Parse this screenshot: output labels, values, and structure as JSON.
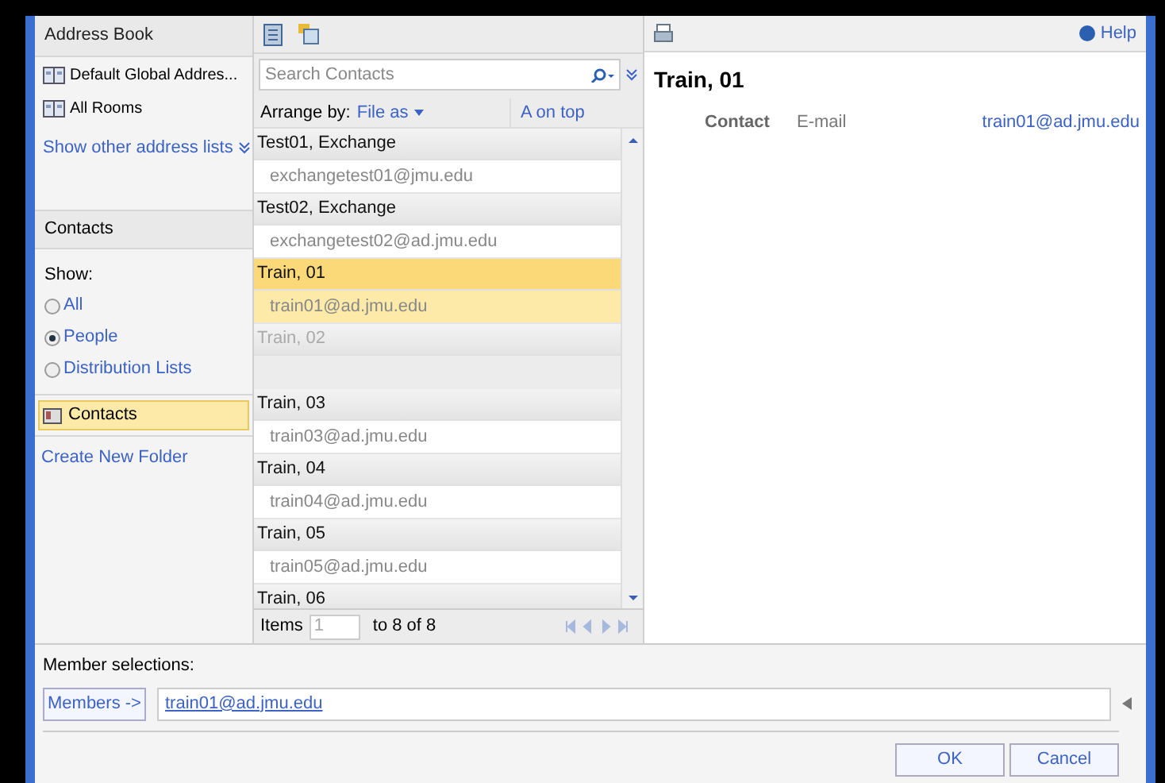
{
  "address_book": {
    "title": "Address Book",
    "lists": [
      {
        "label": "Default Global Addres...",
        "selected": false
      },
      {
        "label": "All Rooms",
        "selected": false
      }
    ],
    "more_link": "Show other address lists"
  },
  "contacts_panel": {
    "title": "Contacts",
    "show_label": "Show:",
    "options": [
      {
        "label": "All",
        "selected": false
      },
      {
        "label": "People",
        "selected": true
      },
      {
        "label": "Distribution Lists",
        "selected": false
      }
    ],
    "folders": [
      {
        "label": "Contacts",
        "selected": true
      }
    ],
    "create_link": "Create New Folder"
  },
  "search": {
    "placeholder": "Search Contacts"
  },
  "arrange": {
    "label": "Arrange by:",
    "value": "File as",
    "order": "A on top"
  },
  "contacts": [
    {
      "name": "Test01, Exchange",
      "email": "exchangetest01@jmu.edu",
      "selected": false,
      "disabled": false
    },
    {
      "name": "Test02, Exchange",
      "email": "exchangetest02@ad.jmu.edu",
      "selected": false,
      "disabled": false
    },
    {
      "name": "Train, 01",
      "email": "train01@ad.jmu.edu",
      "selected": true,
      "disabled": false
    },
    {
      "name": "Train, 02",
      "selected": false,
      "disabled": true
    },
    {
      "name": "Train, 03",
      "email": "train03@ad.jmu.edu",
      "selected": false,
      "disabled": false
    },
    {
      "name": "Train, 04",
      "email": "train04@ad.jmu.edu",
      "selected": false,
      "disabled": false
    },
    {
      "name": "Train, 05",
      "email": "train05@ad.jmu.edu",
      "selected": false,
      "disabled": false
    },
    {
      "name": "Train, 06",
      "selected": false,
      "disabled": false
    }
  ],
  "pager": {
    "label": "Items",
    "placeholder": "1",
    "range": "to 8 of 8"
  },
  "detail": {
    "help": "Help",
    "name": "Train, 01",
    "section": "Contact",
    "field_label": "E-mail",
    "field_value": "train01@ad.jmu.edu"
  },
  "members": {
    "title": "Member selections:",
    "button": "Members ->",
    "value": "train01@ad.jmu.edu"
  },
  "buttons": [
    "OK",
    "Cancel"
  ]
}
